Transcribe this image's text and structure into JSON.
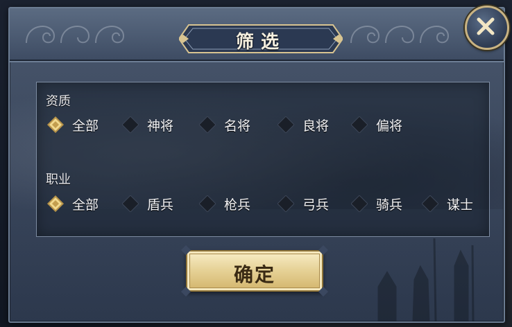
{
  "dialog": {
    "title": "筛选",
    "close_icon": "close-x-icon",
    "confirm_label": "确定"
  },
  "filters": {
    "quality": {
      "label": "资质",
      "selected_index": 0,
      "options": [
        "全部",
        "神将",
        "名将",
        "良将",
        "偏将"
      ]
    },
    "profession": {
      "label": "职业",
      "selected_index": 0,
      "options": [
        "全部",
        "盾兵",
        "枪兵",
        "弓兵",
        "骑兵",
        "谋士"
      ]
    }
  },
  "colors": {
    "gold": "#c9b382",
    "panel_border": "#7d8ca2",
    "diamond_unselected": "#1a1f28",
    "diamond_selected": "#e6c97a"
  }
}
